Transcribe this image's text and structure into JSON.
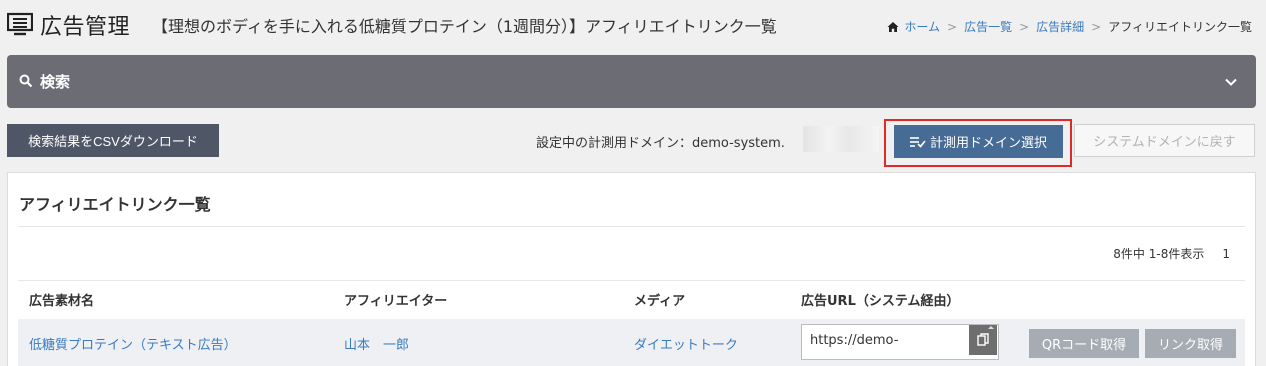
{
  "header": {
    "title": "広告管理",
    "subtitle": "【理想のボディを手に入れる低糖質プロテイン（1週間分）】アフィリエイトリンク一覧",
    "icon": "list-screen-icon"
  },
  "breadcrumb": {
    "home": "ホーム",
    "items": [
      "広告一覧",
      "広告詳細"
    ],
    "current": "アフィリエイトリンク一覧",
    "separator": ">"
  },
  "search": {
    "label": "検索",
    "icon": "search-icon",
    "toggle_icon": "chevron-down-icon"
  },
  "toolbar": {
    "csv_label": "検索結果をCSVダウンロード",
    "domain_label": "設定中の計測用ドメイン：demo-system.",
    "select_domain_label": "計測用ドメイン選択",
    "reset_domain_label": "システムドメインに戻す"
  },
  "panel": {
    "title": "アフィリエイトリンク一覧",
    "pagination": "8件中 1-8件表示",
    "page_number": "1"
  },
  "table": {
    "columns": [
      "広告素材名",
      "アフィリエイター",
      "メディア",
      "広告URL（システム経由）"
    ],
    "rows": [
      {
        "material": "低糖質プロテイン（テキスト広告）",
        "affiliate": "山本　一郎",
        "media": "ダイエットトーク",
        "url": "https://demo-",
        "qr_label": "QRコード取得",
        "link_label": "リンク取得"
      }
    ]
  },
  "colors": {
    "search_bar": "#6b6c74",
    "primary_button": "#466c96",
    "csv_button": "#4f5766",
    "highlight": "#e02a2a",
    "link": "#3a7bbf",
    "disabled_button": "#a6acb3"
  }
}
